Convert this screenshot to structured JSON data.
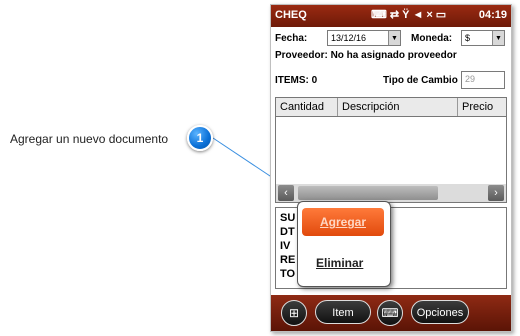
{
  "callout": {
    "number": "1",
    "text": "Agregar un nuevo documento"
  },
  "statusbar": {
    "title": "CHEQ",
    "icons": [
      "keyboard-icon",
      "connectivity-icon",
      "no-signal-icon",
      "speaker-mute-icon",
      "battery-icon"
    ],
    "time": "04:19"
  },
  "form": {
    "fecha_label": "Fecha:",
    "fecha_value": "13/12/16",
    "moneda_label": "Moneda:",
    "moneda_value": "$",
    "proveedor": "Proveedor: No ha asignado proveedor",
    "items_label": "ITEMS: 0",
    "tipo_cambio_label": "Tipo de Cambio",
    "tipo_cambio_value": "29"
  },
  "grid": {
    "columns": [
      "Cantidad",
      "Descripción",
      "Precio"
    ]
  },
  "totals": [
    "SU",
    "DT",
    "IV",
    "RE",
    "TO"
  ],
  "popup": {
    "agregar": "Agregar",
    "eliminar": "Eliminar"
  },
  "bottombar": {
    "item_label": "Item",
    "opciones_label": "Opciones"
  },
  "colors": {
    "statusbar": "#7e200c",
    "accent": "#e8561a",
    "callout": "#0a6fd6"
  }
}
